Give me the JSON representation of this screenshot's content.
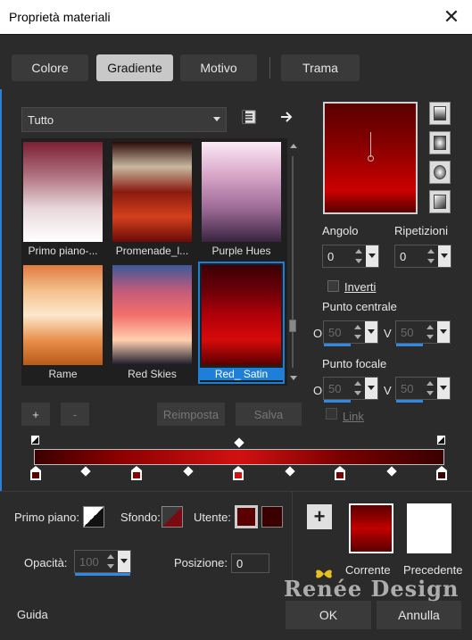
{
  "window": {
    "title": "Proprietà materiali",
    "close_glyph": "✕"
  },
  "tabs": [
    {
      "label": "Colore",
      "active": false
    },
    {
      "label": "Gradiente",
      "active": true
    },
    {
      "label": "Motivo",
      "active": false
    },
    {
      "label": "Trama",
      "active": false
    }
  ],
  "category_select": {
    "value": "Tutto"
  },
  "icons": {
    "library": "book-icon",
    "arrow": "arrow-right-icon"
  },
  "gallery": {
    "items": [
      {
        "label": "Primo piano-...",
        "gradient": [
          "#7a2033",
          "#b0707e",
          "#e8d8dc",
          "#ffffff"
        ],
        "selected": false
      },
      {
        "label": "Promenade_l...",
        "gradient": [
          "#2b0a06",
          "#c8b8a0",
          "#8a1a10",
          "#d4401c",
          "#6a0a08"
        ],
        "selected": false
      },
      {
        "label": "Purple Hues",
        "gradient": [
          "#fbeaf6",
          "#d8a6c8",
          "#9c6a96",
          "#3a2440"
        ],
        "selected": false
      },
      {
        "label": "Rame",
        "gradient": [
          "#e07a40",
          "#f4c08a",
          "#fce8cc",
          "#e8904c",
          "#b85a1a"
        ],
        "selected": false
      },
      {
        "label": "Red Skies",
        "gradient": [
          "#3a5a9a",
          "#c05a7a",
          "#f2706a",
          "#ffd0b0",
          "#1a1a2a"
        ],
        "selected": false
      },
      {
        "label": "Red_ Satin",
        "gradient": [
          "#3c0006",
          "#6a0008",
          "#b0000a",
          "#d60a0a",
          "#5a0000"
        ],
        "selected": true
      }
    ]
  },
  "buttons": {
    "add": "+",
    "remove": "-",
    "reset": "Reimposta",
    "save": "Salva",
    "ok": "OK",
    "cancel": "Annulla",
    "help": "Guida"
  },
  "angle": {
    "label": "Angolo",
    "value": "0"
  },
  "repeats": {
    "label": "Ripetizioni",
    "value": "0"
  },
  "invert": {
    "label": "Inverti",
    "checked": false
  },
  "center_point": {
    "label": "Punto centrale",
    "h_label": "O",
    "h_value": "50",
    "v_label": "V",
    "v_value": "50"
  },
  "focal_point": {
    "label": "Punto focale",
    "h_label": "O",
    "h_value": "50",
    "v_label": "V",
    "v_value": "50"
  },
  "link": {
    "label": "Link",
    "checked": false
  },
  "colors": {
    "foreground_label": "Primo piano:",
    "background_label": "Sfondo:",
    "user_label": "Utente:",
    "user_color_1": "#5a0000",
    "user_color_2": "#3a0000"
  },
  "opacity": {
    "label": "Opacità:",
    "value": "100"
  },
  "position": {
    "label": "Posizione:",
    "value": "0"
  },
  "preview": {
    "current_label": "Corrente",
    "previous_label": "Precedente"
  },
  "watermark": "Renée Design"
}
